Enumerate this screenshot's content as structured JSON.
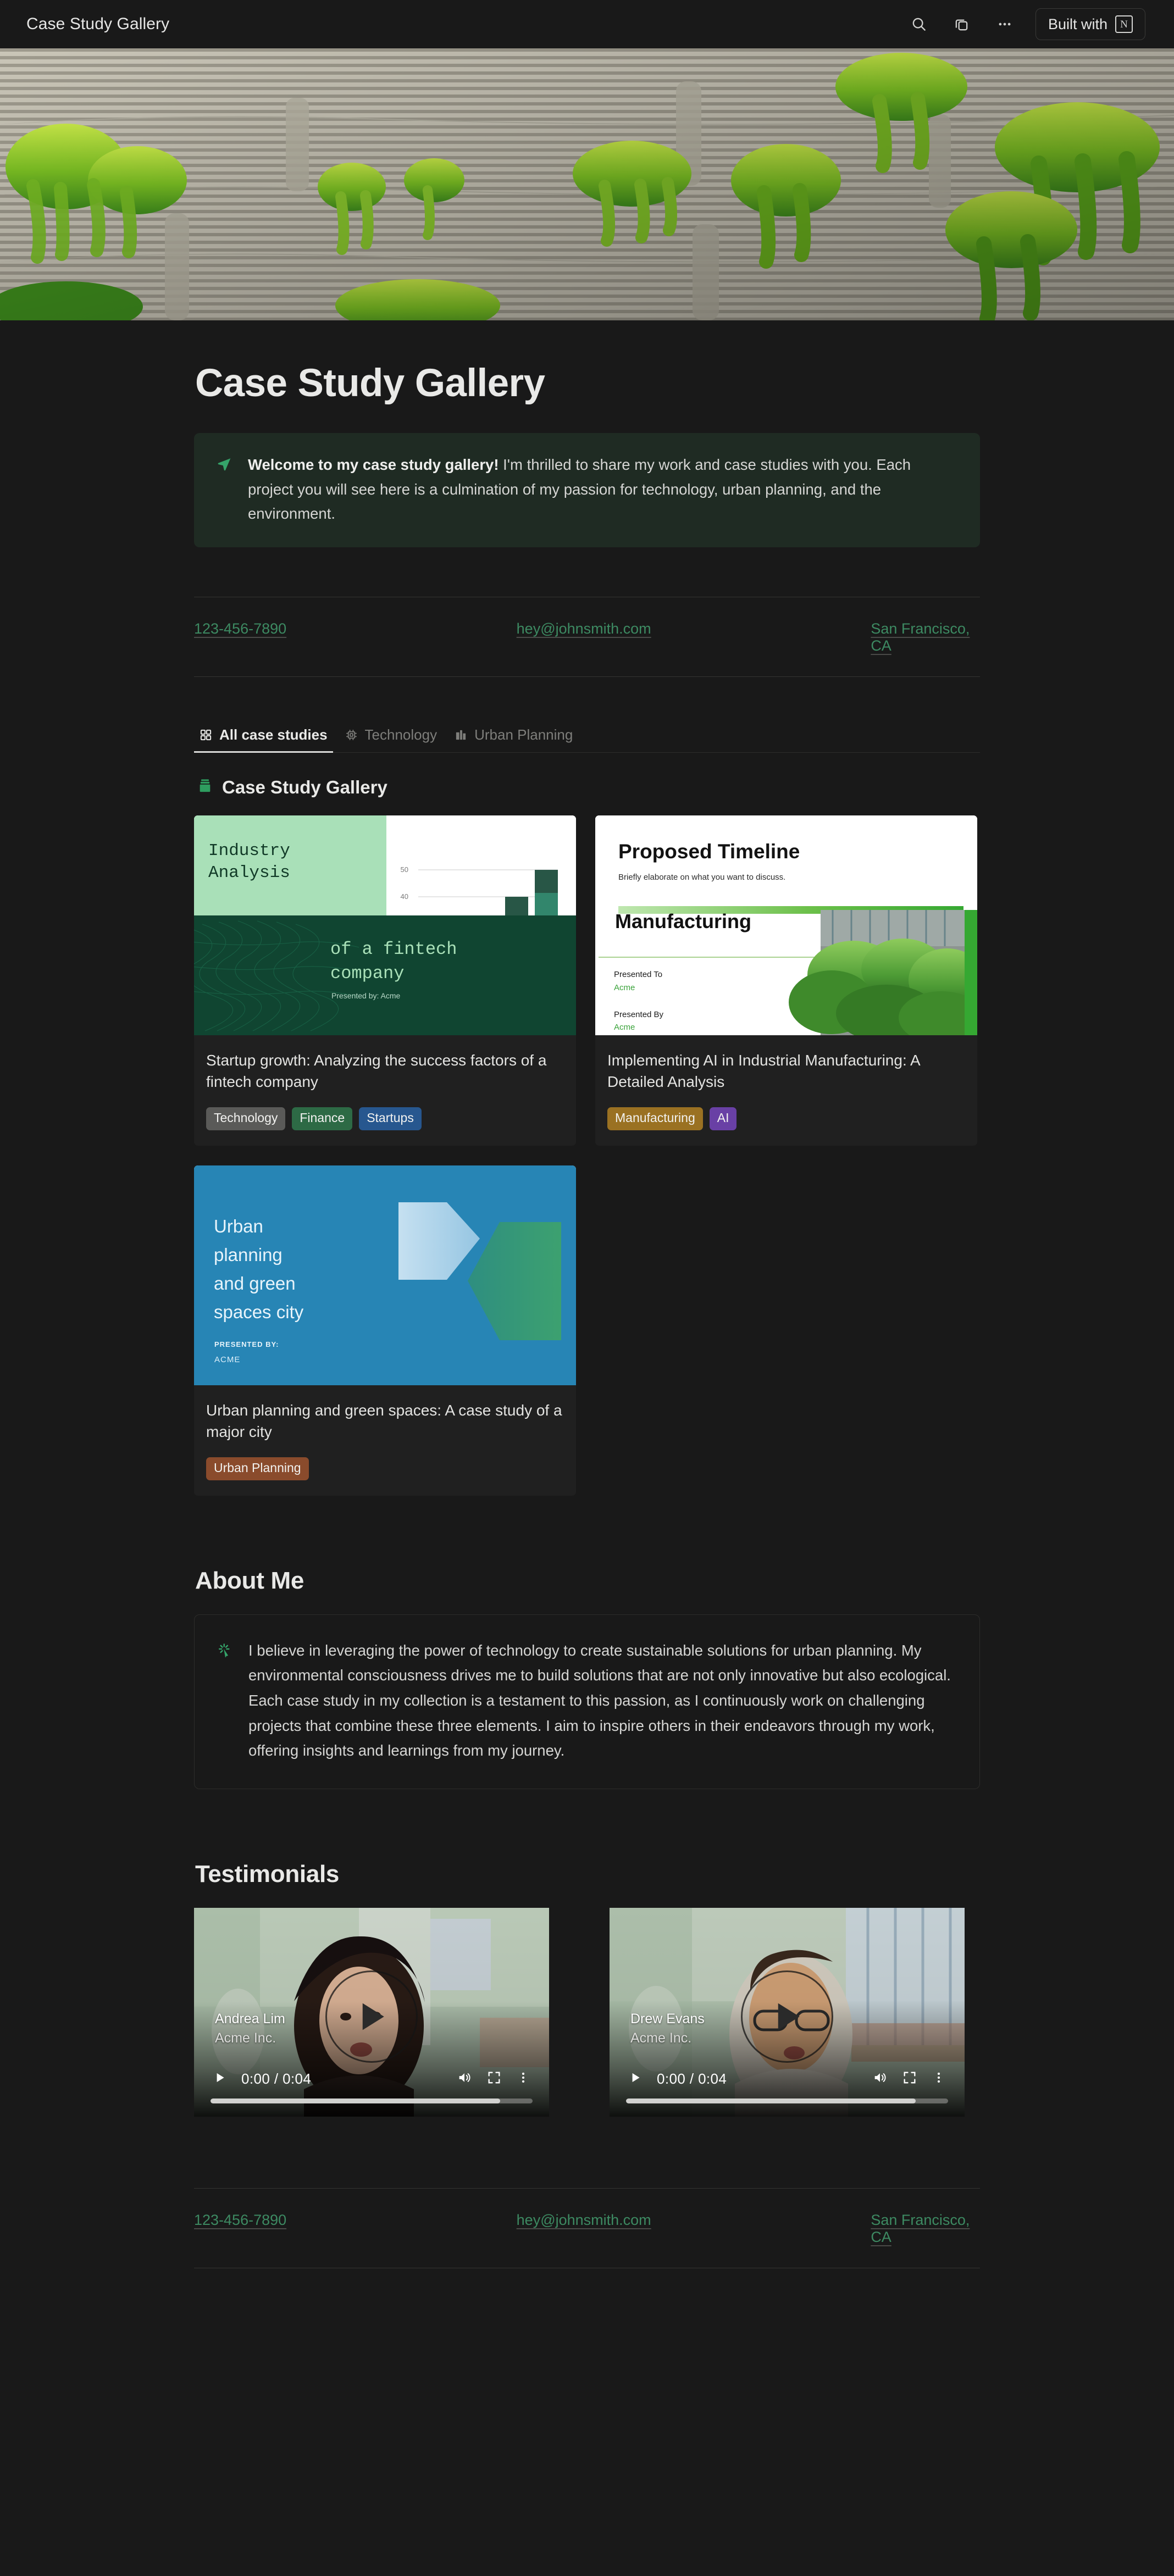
{
  "topbar": {
    "title": "Case Study Gallery",
    "search_icon": "search-icon",
    "duplicate_icon": "duplicate-icon",
    "more_icon": "more-options-icon",
    "built_with_label": "Built with",
    "built_with_mark": "N"
  },
  "page": {
    "title": "Case Study Gallery"
  },
  "callout": {
    "icon": "paper-plane-icon",
    "lead": "Welcome to my case study gallery!",
    "body": " I'm thrilled to share my work and case studies with you. Each project you will see here is a culmination of my passion for technology, urban planning, and the environment."
  },
  "contact": {
    "phone": "123-456-7890",
    "email": "hey@johnsmith.com",
    "location": "San Francisco, CA"
  },
  "tabs": [
    {
      "label": "All case studies",
      "icon": "grid-icon",
      "active": true
    },
    {
      "label": "Technology",
      "icon": "chip-icon",
      "active": false
    },
    {
      "label": "Urban Planning",
      "icon": "building-icon",
      "active": false
    }
  ],
  "gallery": {
    "icon": "books-icon",
    "title": "Case Study Gallery",
    "cards": [
      {
        "title": "Startup growth: Analyzing the success factors of a fintech company",
        "tags": [
          {
            "label": "Technology",
            "color": "#5a5a58"
          },
          {
            "label": "Finance",
            "color": "#2d6a45"
          },
          {
            "label": "Startups",
            "color": "#27578f"
          }
        ],
        "thumb": {
          "kind": "fintech-deck",
          "panel_title": "Industry Analysis",
          "headline": "of a fintech company",
          "presenter": "Presented by: Acme",
          "chart_axis": [
            "50",
            "40"
          ]
        }
      },
      {
        "title": "Implementing AI in Industrial Manufacturing: A Detailed Analysis",
        "tags": [
          {
            "label": "Manufacturing",
            "color": "#9a7122"
          },
          {
            "label": "AI",
            "color": "#6940a5"
          }
        ],
        "thumb": {
          "kind": "timeline-deck",
          "heading": "Proposed Timeline",
          "subheading": "Briefly elaborate on what you want to discuss.",
          "section": "Manufacturing",
          "presented_to_label": "Presented To",
          "presented_to": "Acme",
          "presented_by_label": "Presented By",
          "presented_by": "Acme"
        }
      },
      {
        "title": "Urban planning and green spaces: A case study of a major city",
        "tags": [
          {
            "label": "Urban Planning",
            "color": "#8a4b2c"
          }
        ],
        "thumb": {
          "kind": "urban-deck",
          "headline": "Urban planning and green spaces city",
          "presented_label": "PRESENTED BY:",
          "presenter": "ACME"
        }
      }
    ]
  },
  "about": {
    "heading": "About Me",
    "icon": "click-sparkle-icon",
    "text": "I believe in leveraging the power of technology to create sustainable solutions for urban planning. My environmental consciousness drives me to build solutions that are not only innovative but also ecological. Each case study in my collection is a testament to this passion, as I continuously work on challenging projects that combine these three elements. I aim to inspire others in their endeavors through my work, offering insights and learnings from my journey."
  },
  "testimonials": {
    "heading": "Testimonials",
    "videos": [
      {
        "name": "Andrea Lim",
        "company": "Acme Inc.",
        "time": "0:00 / 0:04",
        "play_icon": "play-icon",
        "volume_icon": "volume-icon",
        "fullscreen_icon": "fullscreen-icon",
        "more_icon": "more-options-icon"
      },
      {
        "name": "Drew Evans",
        "company": "Acme Inc.",
        "time": "0:00 / 0:04",
        "play_icon": "play-icon",
        "volume_icon": "volume-icon",
        "fullscreen_icon": "fullscreen-icon",
        "more_icon": "more-options-icon"
      }
    ]
  },
  "footer": {
    "phone": "123-456-7890",
    "email": "hey@johnsmith.com",
    "location": "San Francisco, CA"
  },
  "colors": {
    "page_bg": "#191919",
    "accent_green": "#3d8a62",
    "callout_bg": "#1f2b23",
    "card_bg": "#202020"
  }
}
